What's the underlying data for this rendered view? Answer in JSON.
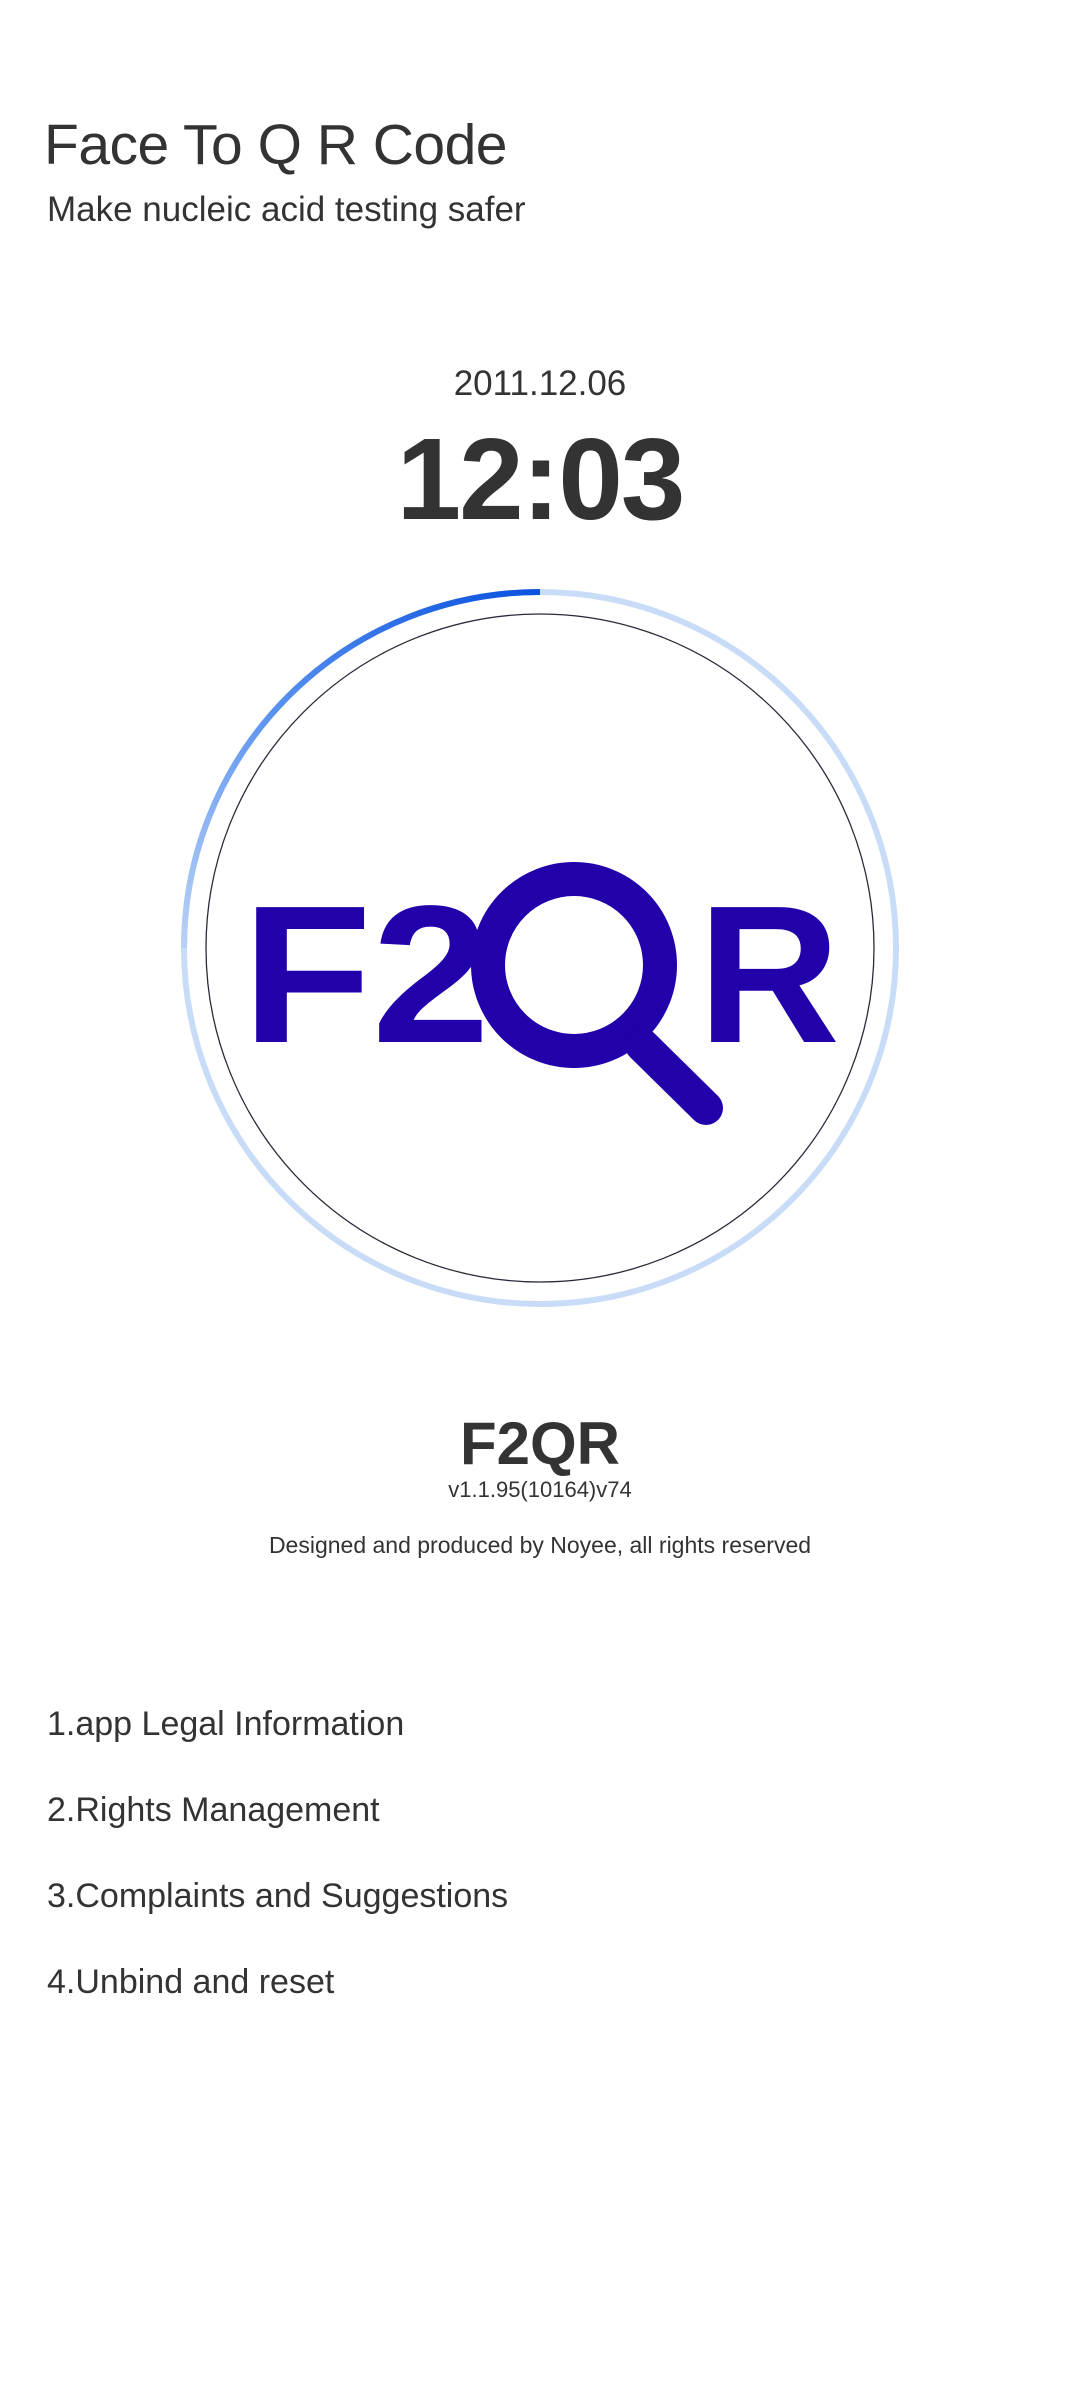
{
  "header": {
    "title": "Face To Q R Code",
    "subtitle": "Make nucleic acid testing safer"
  },
  "clock": {
    "date": "2011.12.06",
    "time": "12:03"
  },
  "logo": {
    "text_left": "F2",
    "text_right": "R",
    "icon": "magnifier-q-icon",
    "color": "#2200aa"
  },
  "progress_ring": {
    "progress_fraction": 0.25,
    "progress_color": "#1a5fe0",
    "track_color": "#c9dcf7",
    "inner_circle_color": "#2a2a3a"
  },
  "about": {
    "app_name": "F2QR",
    "version": "v1.1.95(10164)v74",
    "copyright": "Designed and produced by Noyee, all rights reserved"
  },
  "menu": {
    "items": [
      {
        "label": "1.app Legal Information"
      },
      {
        "label": "2.Rights Management"
      },
      {
        "label": "3.Complaints and Suggestions"
      },
      {
        "label": "4.Unbind and reset"
      }
    ]
  }
}
